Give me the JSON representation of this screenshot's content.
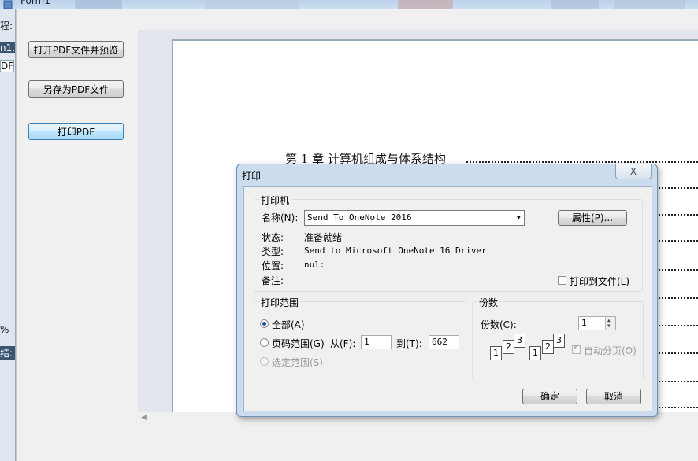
{
  "window": {
    "title": "Form1"
  },
  "left_strip": {
    "fragments": [
      "程:",
      "n1.",
      "DF",
      "%",
      "结:"
    ]
  },
  "buttons": {
    "open_preview": "打开PDF文件并预览",
    "save_as": "另存为PDF文件",
    "print": "打印PDF"
  },
  "document": {
    "chapter_heading": "第 1 章  计算机组成与体系结构"
  },
  "print_dialog": {
    "title": "打印",
    "close_glyph": "X",
    "printer": {
      "group_title": "打印机",
      "name_label": "名称(N):",
      "name_value": "Send To OneNote 2016",
      "properties_button": "属性(P)...",
      "status_label": "状态:",
      "status_value": "准备就绪",
      "type_label": "类型:",
      "type_value": "Send to Microsoft OneNote 16 Driver",
      "where_label": "位置:",
      "where_value": "nul:",
      "comment_label": "备注:",
      "print_to_file_label": "打印到文件(L)",
      "print_to_file_checked": false
    },
    "range": {
      "group_title": "打印范围",
      "all_label": "全部(A)",
      "all_selected": true,
      "pages_label": "页码范围(G)",
      "from_label": "从(F):",
      "from_value": "1",
      "to_label": "到(T):",
      "to_value": "662",
      "selection_label": "选定范围(S)"
    },
    "copies": {
      "group_title": "份数",
      "label": "份数(C):",
      "value": "1",
      "collate_label": "自动分页(O)",
      "collate_checked": true,
      "collate_digits": [
        "1",
        "2",
        "3"
      ]
    },
    "ok_button": "确定",
    "cancel_button": "取消"
  }
}
